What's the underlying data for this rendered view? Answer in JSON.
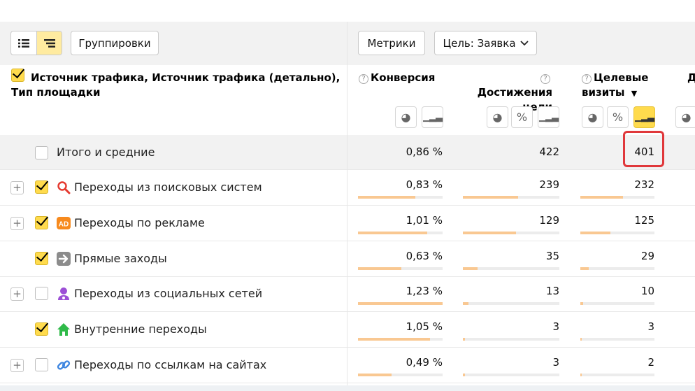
{
  "toolbar": {
    "groupings_label": "Группировки",
    "metrics_label": "Метрики",
    "goal_label": "Цель: Заявка"
  },
  "header": {
    "dimension_title": "Источник трафика, Источник трафика (детально), Тип площадки",
    "columns": [
      {
        "label": "Конверсия"
      },
      {
        "label": "Достижения цели"
      },
      {
        "label": "Целевые визиты",
        "sort": "▼"
      },
      {
        "label": "Д"
      }
    ]
  },
  "total": {
    "label": "Итого и средние",
    "conversion": "0,86 %",
    "achievements": "422",
    "target_visits": "401"
  },
  "rows": [
    {
      "label": "Переходы из поисковых систем",
      "icon": "search-icon",
      "conversion": "0,83 %",
      "achievements": "239",
      "target_visits": "232",
      "checked": true,
      "expandable": true,
      "conv_frac": 0.68,
      "ach_frac": 0.57,
      "tv_frac": 0.58
    },
    {
      "label": "Переходы по рекламе",
      "icon": "ad-icon",
      "conversion": "1,01 %",
      "achievements": "129",
      "target_visits": "125",
      "checked": true,
      "expandable": true,
      "conv_frac": 0.82,
      "ach_frac": 0.55,
      "tv_frac": 0.41
    },
    {
      "label": "Прямые заходы",
      "icon": "arrow-right-icon",
      "conversion": "0,63 %",
      "achievements": "35",
      "target_visits": "29",
      "checked": true,
      "expandable": false,
      "conv_frac": 0.51,
      "ach_frac": 0.15,
      "tv_frac": 0.11
    },
    {
      "label": "Переходы из социальных сетей",
      "icon": "social-user-icon",
      "conversion": "1,23 %",
      "achievements": "13",
      "target_visits": "10",
      "checked": false,
      "expandable": true,
      "conv_frac": 1.0,
      "ach_frac": 0.06,
      "tv_frac": 0.04
    },
    {
      "label": "Внутренние переходы",
      "icon": "home-icon",
      "conversion": "1,05 %",
      "achievements": "3",
      "target_visits": "3",
      "checked": true,
      "expandable": false,
      "conv_frac": 0.85,
      "ach_frac": 0.02,
      "tv_frac": 0.02
    },
    {
      "label": "Переходы по ссылкам на сайтах",
      "icon": "link-icon",
      "conversion": "0,49 %",
      "achievements": "3",
      "target_visits": "2",
      "checked": false,
      "expandable": true,
      "conv_frac": 0.4,
      "ach_frac": 0.02,
      "tv_frac": 0.01
    }
  ],
  "colors": {
    "accent": "#ffdb4d",
    "bar": "#f9c892",
    "highlight": "#e0383b"
  }
}
